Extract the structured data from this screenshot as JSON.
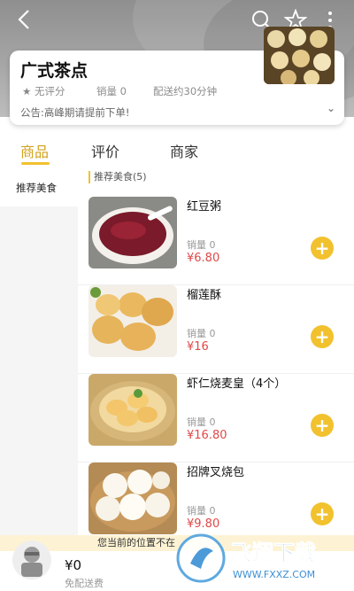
{
  "store": {
    "name": "广式茶点",
    "rating": "无评分",
    "sales": "销量 0",
    "delivery_time": "配送约30分钟",
    "notice": "公告:高峰期请提前下单!"
  },
  "tabs": [
    {
      "label": "商品",
      "active": true
    },
    {
      "label": "评价",
      "active": false
    },
    {
      "label": "商家",
      "active": false
    }
  ],
  "sidebar": {
    "items": [
      {
        "label": "推荐美食",
        "active": true
      }
    ]
  },
  "section": {
    "title": "推荐美食(5)"
  },
  "products": [
    {
      "name": "红豆粥",
      "sales": "销量 0",
      "price": "¥6.80"
    },
    {
      "name": "榴莲酥",
      "sales": "销量 0",
      "price": "¥16"
    },
    {
      "name": "虾仁烧麦皇（4个）",
      "sales": "销量 0",
      "price": "¥16.80"
    },
    {
      "name": "招牌叉烧包",
      "sales": "销量 0",
      "price": "¥9.80"
    }
  ],
  "location_banner": "您当前的位置不在",
  "cart": {
    "total": "¥0",
    "delivery": "免配送费"
  },
  "watermark": {
    "brand": "飞翔下载",
    "url": "WWW.FXXZ.COM"
  },
  "icons": {
    "back": "back-arrow-icon",
    "search": "search-icon",
    "favorite": "star-icon",
    "more": "more-vertical-icon",
    "add": "plus-icon",
    "cart": "cart-icon"
  },
  "colors": {
    "accent": "#f2c12e",
    "price": "#e04848",
    "active_tab": "#d3a11a"
  }
}
